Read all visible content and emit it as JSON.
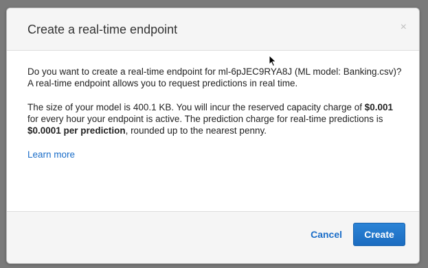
{
  "dialog": {
    "title": "Create a real-time endpoint",
    "close_symbol": "×",
    "paragraph1": "Do you want to create a real-time endpoint for ml-6pJEC9RYA8J (ML model: Banking.csv)? A real-time endpoint allows you to request predictions in real time.",
    "paragraph2": {
      "part1": "The size of your model is 400.1 KB. You will incur the reserved capacity charge of ",
      "price1": "$0.001",
      "part2": " for every hour your endpoint is active. The prediction charge for real-time predictions is ",
      "price2": "$0.0001 per prediction",
      "part3": ", rounded up to the nearest penny."
    },
    "learn_more": "Learn more",
    "cancel_label": "Cancel",
    "create_label": "Create"
  },
  "icons": {
    "close": "close-icon",
    "cursor": "mouse-pointer-icon"
  },
  "colors": {
    "accent": "#1a6dc8",
    "primary_button": "#1b6cc0",
    "header_bg": "#f5f5f5"
  }
}
